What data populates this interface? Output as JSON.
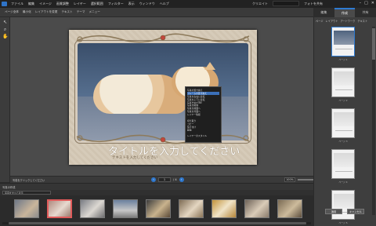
{
  "menubar": {
    "menus": [
      "ファイル",
      "編集",
      "イメージ",
      "画質調整",
      "レイヤー",
      "選択範囲",
      "フィルター",
      "表示",
      "ウィンドウ",
      "ヘルプ"
    ],
    "right": [
      "クリエイト",
      "フォトを共有"
    ]
  },
  "optionsbar": {
    "items": [
      "ページ全体",
      "最小化",
      "レイアウトを変更",
      "テキスト",
      "テーマ",
      "メニュー"
    ]
  },
  "right_tabs": [
    "編集",
    "作成",
    "共有"
  ],
  "right_panel": {
    "subtabs": [
      "ページ",
      "レイアウト",
      "アートワーク",
      "テキスト"
    ],
    "thumb_captions": [
      "ページ 1",
      "ページ 2",
      "ページ 3",
      "ページ 4",
      "ページ 5"
    ],
    "buttons": [
      "適用",
      "キャンセル"
    ]
  },
  "canvas": {
    "title_text": "タイトルを入力してください",
    "sub_text": "テキストを入力してください",
    "context_menu": [
      "写真の置き換え",
      "フレームの置き換え",
      "写真を左右に反転",
      "写真を上下に反転",
      "写真を90°回転",
      "写真を削除",
      "写真を前面へ",
      "写真を背面へ",
      "レイヤー情報",
      "---",
      "切り取り",
      "コピー",
      "貼り付け",
      "削除",
      "---",
      "レイヤーのスタイル"
    ],
    "context_highlight_index": 1
  },
  "canvas_controls": {
    "label": "写真をクリックしてください",
    "page": "1",
    "page_total": "/ 4",
    "zoom": "100%"
  },
  "photobin": {
    "label": "写真の作成",
    "dropdown": "写真をすべて表示"
  }
}
